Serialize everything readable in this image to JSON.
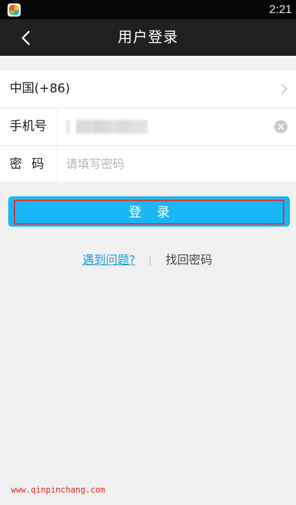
{
  "status_bar": {
    "time": "2:21",
    "app_icon": "app-logo-icon"
  },
  "header": {
    "title": "用户登录",
    "back_icon": "chevron-left-icon"
  },
  "form": {
    "country": {
      "label": "中国(+86)",
      "icon": "chevron-right-icon"
    },
    "phone": {
      "label": "手机号",
      "value_masked": true,
      "clear_icon": "clear-circle-icon"
    },
    "password": {
      "label": "密码",
      "placeholder": "请填写密码",
      "value": ""
    }
  },
  "actions": {
    "login_label": "登录",
    "login_color": "#1ab7f5",
    "highlight_color": "#d33a32"
  },
  "help": {
    "problem_link": "遇到问题?",
    "recover_link": "找回密码"
  },
  "watermark": "www.qinpinchang.com"
}
